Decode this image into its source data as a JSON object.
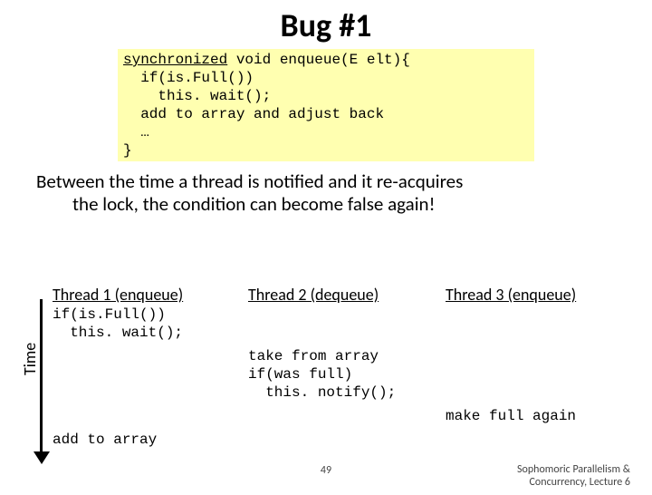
{
  "title": "Bug #1",
  "code": {
    "l1a": "synchronized",
    "l1b": " void enqueue(E elt){",
    "l2": "  if(is.Full())",
    "l3": "    this. wait();",
    "l4": "  add to array and adjust back",
    "l5": "  …",
    "l6": "}"
  },
  "explain1": "Between the time a thread is notified and it re-acquires",
  "explain2": "the lock, the condition can become false again!",
  "cols": {
    "h1": "Thread 1 (enqueue)",
    "h2": "Thread 2 (dequeue)",
    "h3": "Thread 3 (enqueue)"
  },
  "t1": {
    "a": "if(is.Full())\n  this. wait();",
    "b": "add to array"
  },
  "t2": {
    "a": "take from array\nif(was full)\n  this. notify();"
  },
  "t3": {
    "a": "make full again"
  },
  "time_label": "Time",
  "footer": {
    "page": "49",
    "right1": "Sophomoric Parallelism &",
    "right2": "Concurrency, Lecture 6"
  }
}
